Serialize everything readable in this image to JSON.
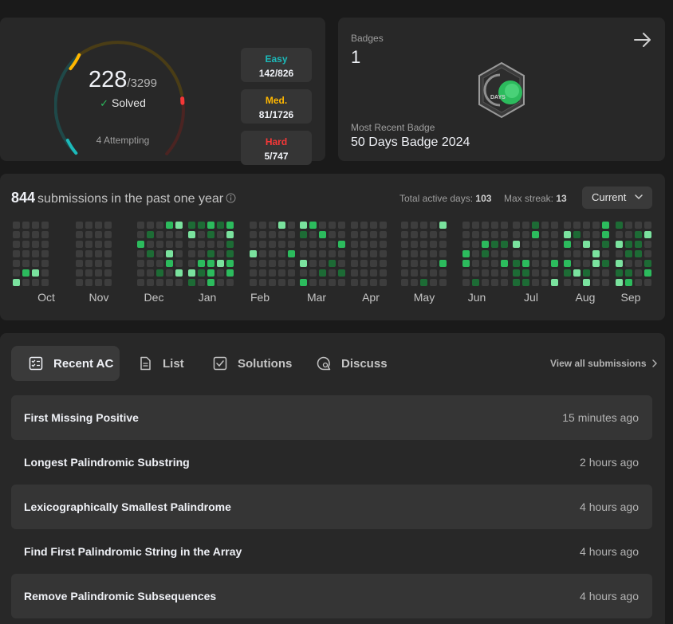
{
  "colors": {
    "easy": "#1cbaba",
    "medium": "#ffb700",
    "hard": "#f63737",
    "accent_green": "#2cbb5d",
    "card_bg": "#282828",
    "page_bg": "#1a1a1a"
  },
  "progress": {
    "solved": "228",
    "total": "/3299",
    "solved_label": "Solved",
    "attempting": "4 Attempting",
    "easy": {
      "label": "Easy",
      "value": "142/826"
    },
    "medium": {
      "label": "Med.",
      "value": "81/1726"
    },
    "hard": {
      "label": "Hard",
      "value": "5/747"
    }
  },
  "badges": {
    "label": "Badges",
    "count": "1",
    "badge_icon": "50-days-badge-icon",
    "badge_text": "DAYS",
    "recent_label": "Most Recent Badge",
    "recent_name": "50 Days Badge 2024"
  },
  "heatmap": {
    "count": "844",
    "text": "submissions in the past one year",
    "active_days_label": "Total active days:",
    "active_days": "103",
    "max_streak_label": "Max streak:",
    "max_streak": "13",
    "period_select": "Current",
    "months": [
      "Oct",
      "Nov",
      "Dec",
      "Jan",
      "Feb",
      "Mar",
      "Apr",
      "May",
      "Jun",
      "Jul",
      "Aug",
      "Sep"
    ]
  },
  "tabs": [
    {
      "label": "Recent AC",
      "icon": "checklist-icon"
    },
    {
      "label": "List",
      "icon": "document-icon"
    },
    {
      "label": "Solutions",
      "icon": "checkbox-icon"
    },
    {
      "label": "Discuss",
      "icon": "discuss-icon"
    }
  ],
  "view_all": "View all submissions",
  "submissions": [
    {
      "title": "First Missing Positive",
      "time": "15 minutes ago"
    },
    {
      "title": "Longest Palindromic Substring",
      "time": "2 hours ago"
    },
    {
      "title": "Lexicographically Smallest Palindrome",
      "time": "4 hours ago"
    },
    {
      "title": "Find First Palindromic String in the Array",
      "time": "4 hours ago"
    },
    {
      "title": "Remove Palindromic Subsequences",
      "time": "4 hours ago"
    }
  ]
}
